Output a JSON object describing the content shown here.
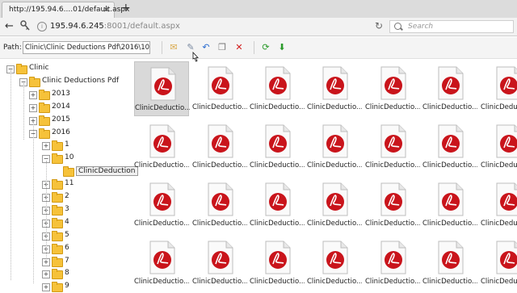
{
  "browser": {
    "tab_title": "http://195.94.6....01/default.aspx",
    "tab_close": "×",
    "new_tab": "+",
    "back": "←",
    "url_main": "195.94.6.245",
    "url_rest": ":8001/default.aspx",
    "refresh": "↻",
    "search_placeholder": "Search"
  },
  "toolbar": {
    "path_label": "Path:",
    "path_value": "Clinic\\Clinic Deductions Pdf\\2016\\10\\ClinicD",
    "buttons": [
      {
        "icon": "open-folder-icon",
        "glyph": "✉",
        "color": "#d9a84a"
      },
      {
        "icon": "edit-icon",
        "glyph": "✎",
        "color": "#7a8aa0"
      },
      {
        "icon": "undo-icon",
        "glyph": "↶",
        "color": "#2a6bd0"
      },
      {
        "icon": "copy-icon",
        "glyph": "❐",
        "color": "#777777"
      },
      {
        "icon": "delete-icon",
        "glyph": "✕",
        "color": "#d21b1b"
      },
      {
        "icon": "refresh-icon",
        "glyph": "⟳",
        "color": "#2a9a2a"
      },
      {
        "icon": "download-icon",
        "glyph": "⬇",
        "color": "#2a9a2a"
      }
    ]
  },
  "tree": {
    "nodes": [
      {
        "label": "Clinic",
        "toggle": "−",
        "level": 0
      },
      {
        "label": "Clinic Deductions Pdf",
        "toggle": "−",
        "level": 1
      },
      {
        "label": "2013",
        "toggle": "+",
        "level": 2
      },
      {
        "label": "2014",
        "toggle": "+",
        "level": 2
      },
      {
        "label": "2015",
        "toggle": "+",
        "level": 2
      },
      {
        "label": "2016",
        "toggle": "−",
        "level": 2
      },
      {
        "label": "1",
        "toggle": "+",
        "level": 3
      },
      {
        "label": "10",
        "toggle": "−",
        "level": 3
      },
      {
        "label": "ClinicDeduction",
        "toggle": "",
        "level": 4,
        "selected": true
      },
      {
        "label": "11",
        "toggle": "+",
        "level": 3
      },
      {
        "label": "2",
        "toggle": "+",
        "level": 3
      },
      {
        "label": "3",
        "toggle": "+",
        "level": 3
      },
      {
        "label": "4",
        "toggle": "+",
        "level": 3
      },
      {
        "label": "5",
        "toggle": "+",
        "level": 3
      },
      {
        "label": "6",
        "toggle": "+",
        "level": 3
      },
      {
        "label": "7",
        "toggle": "+",
        "level": 3
      },
      {
        "label": "8",
        "toggle": "+",
        "level": 3
      },
      {
        "label": "9",
        "toggle": "+",
        "level": 3
      }
    ]
  },
  "files": {
    "file_label": "ClinicDeductio...",
    "rows": 4,
    "cols": 7,
    "selected_index": 0,
    "accent": "#c9141b"
  }
}
